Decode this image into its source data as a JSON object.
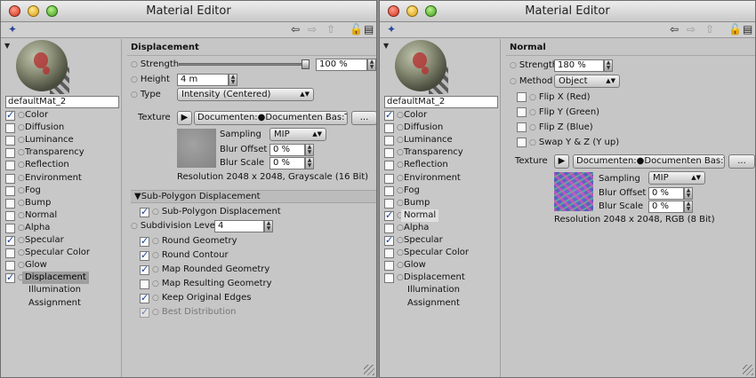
{
  "left_window": {
    "title": "Material Editor",
    "material_name": "defaultMat_2",
    "channels": [
      {
        "label": "Color",
        "checked": true
      },
      {
        "label": "Diffusion",
        "checked": false
      },
      {
        "label": "Luminance",
        "checked": false
      },
      {
        "label": "Transparency",
        "checked": false
      },
      {
        "label": "Reflection",
        "checked": false
      },
      {
        "label": "Environment",
        "checked": false
      },
      {
        "label": "Fog",
        "checked": false
      },
      {
        "label": "Bump",
        "checked": false
      },
      {
        "label": "Normal",
        "checked": false
      },
      {
        "label": "Alpha",
        "checked": false
      },
      {
        "label": "Specular",
        "checked": true
      },
      {
        "label": "Specular Color",
        "checked": false
      },
      {
        "label": "Glow",
        "checked": false
      },
      {
        "label": "Displacement",
        "checked": true
      }
    ],
    "extra_items": [
      "Illumination",
      "Assignment"
    ],
    "section_title": "Displacement",
    "strength_label": "Strength",
    "strength_value": "100 %",
    "height_label": "Height",
    "height_value": "4 m",
    "type_label": "Type",
    "type_value": "Intensity (Centered)",
    "texture_label": "Texture",
    "texture_path": "Documenten:●Documenten Bas:Touri",
    "ellipsis": "...",
    "sampling_label": "Sampling",
    "sampling_value": "MIP",
    "blur_offset_label": "Blur Offset",
    "blur_offset_value": "0 %",
    "blur_scale_label": "Blur Scale",
    "blur_scale_value": "0 %",
    "resolution": "Resolution 2048 x 2048, Grayscale (16 Bit)",
    "subpoly_header": "Sub-Polygon Displacement",
    "subpoly_check": "Sub-Polygon Displacement",
    "subdiv_label": "Subdivision Level",
    "subdiv_value": "4",
    "options": [
      {
        "label": "Round Geometry",
        "checked": true,
        "disabled": false
      },
      {
        "label": "Round Contour",
        "checked": true,
        "disabled": false
      },
      {
        "label": "Map Rounded Geometry",
        "checked": true,
        "disabled": false
      },
      {
        "label": "Map Resulting Geometry",
        "checked": false,
        "disabled": false
      },
      {
        "label": "Keep Original Edges",
        "checked": true,
        "disabled": false
      },
      {
        "label": "Best Distribution",
        "checked": true,
        "disabled": true
      }
    ]
  },
  "right_window": {
    "title": "Material Editor",
    "material_name": "defaultMat_2",
    "channels": [
      {
        "label": "Color",
        "checked": true
      },
      {
        "label": "Diffusion",
        "checked": false
      },
      {
        "label": "Luminance",
        "checked": false
      },
      {
        "label": "Transparency",
        "checked": false
      },
      {
        "label": "Reflection",
        "checked": false
      },
      {
        "label": "Environment",
        "checked": false
      },
      {
        "label": "Fog",
        "checked": false
      },
      {
        "label": "Bump",
        "checked": false
      },
      {
        "label": "Normal",
        "checked": true
      },
      {
        "label": "Alpha",
        "checked": false
      },
      {
        "label": "Specular",
        "checked": true
      },
      {
        "label": "Specular Color",
        "checked": false
      },
      {
        "label": "Glow",
        "checked": false
      },
      {
        "label": "Displacement",
        "checked": false
      }
    ],
    "extra_items": [
      "Illumination",
      "Assignment"
    ],
    "section_title": "Normal",
    "strength_label": "Strength",
    "strength_value": "180 %",
    "method_label": "Method",
    "method_value": "Object",
    "flips": [
      "Flip X (Red)",
      "Flip Y (Green)",
      "Flip Z (Blue)",
      "Swap Y & Z (Y up)"
    ],
    "texture_label": "Texture",
    "texture_path": "Documenten:●Documenten Bas:Touri",
    "ellipsis": "...",
    "sampling_label": "Sampling",
    "sampling_value": "MIP",
    "blur_offset_label": "Blur Offset",
    "blur_offset_value": "0 %",
    "blur_scale_label": "Blur Scale",
    "blur_scale_value": "0 %",
    "resolution": "Resolution 2048 x 2048, RGB (8 Bit)"
  },
  "toolbar_icons": [
    "pin-icon",
    "back-arrow-icon",
    "forward-arrow-icon",
    "up-arrow-icon",
    "lock-icon",
    "new-window-icon"
  ],
  "colors": {
    "window_bg": "#c6c6c6",
    "selection": "#9e9e9e",
    "checkmark": "#1a3f9a"
  }
}
